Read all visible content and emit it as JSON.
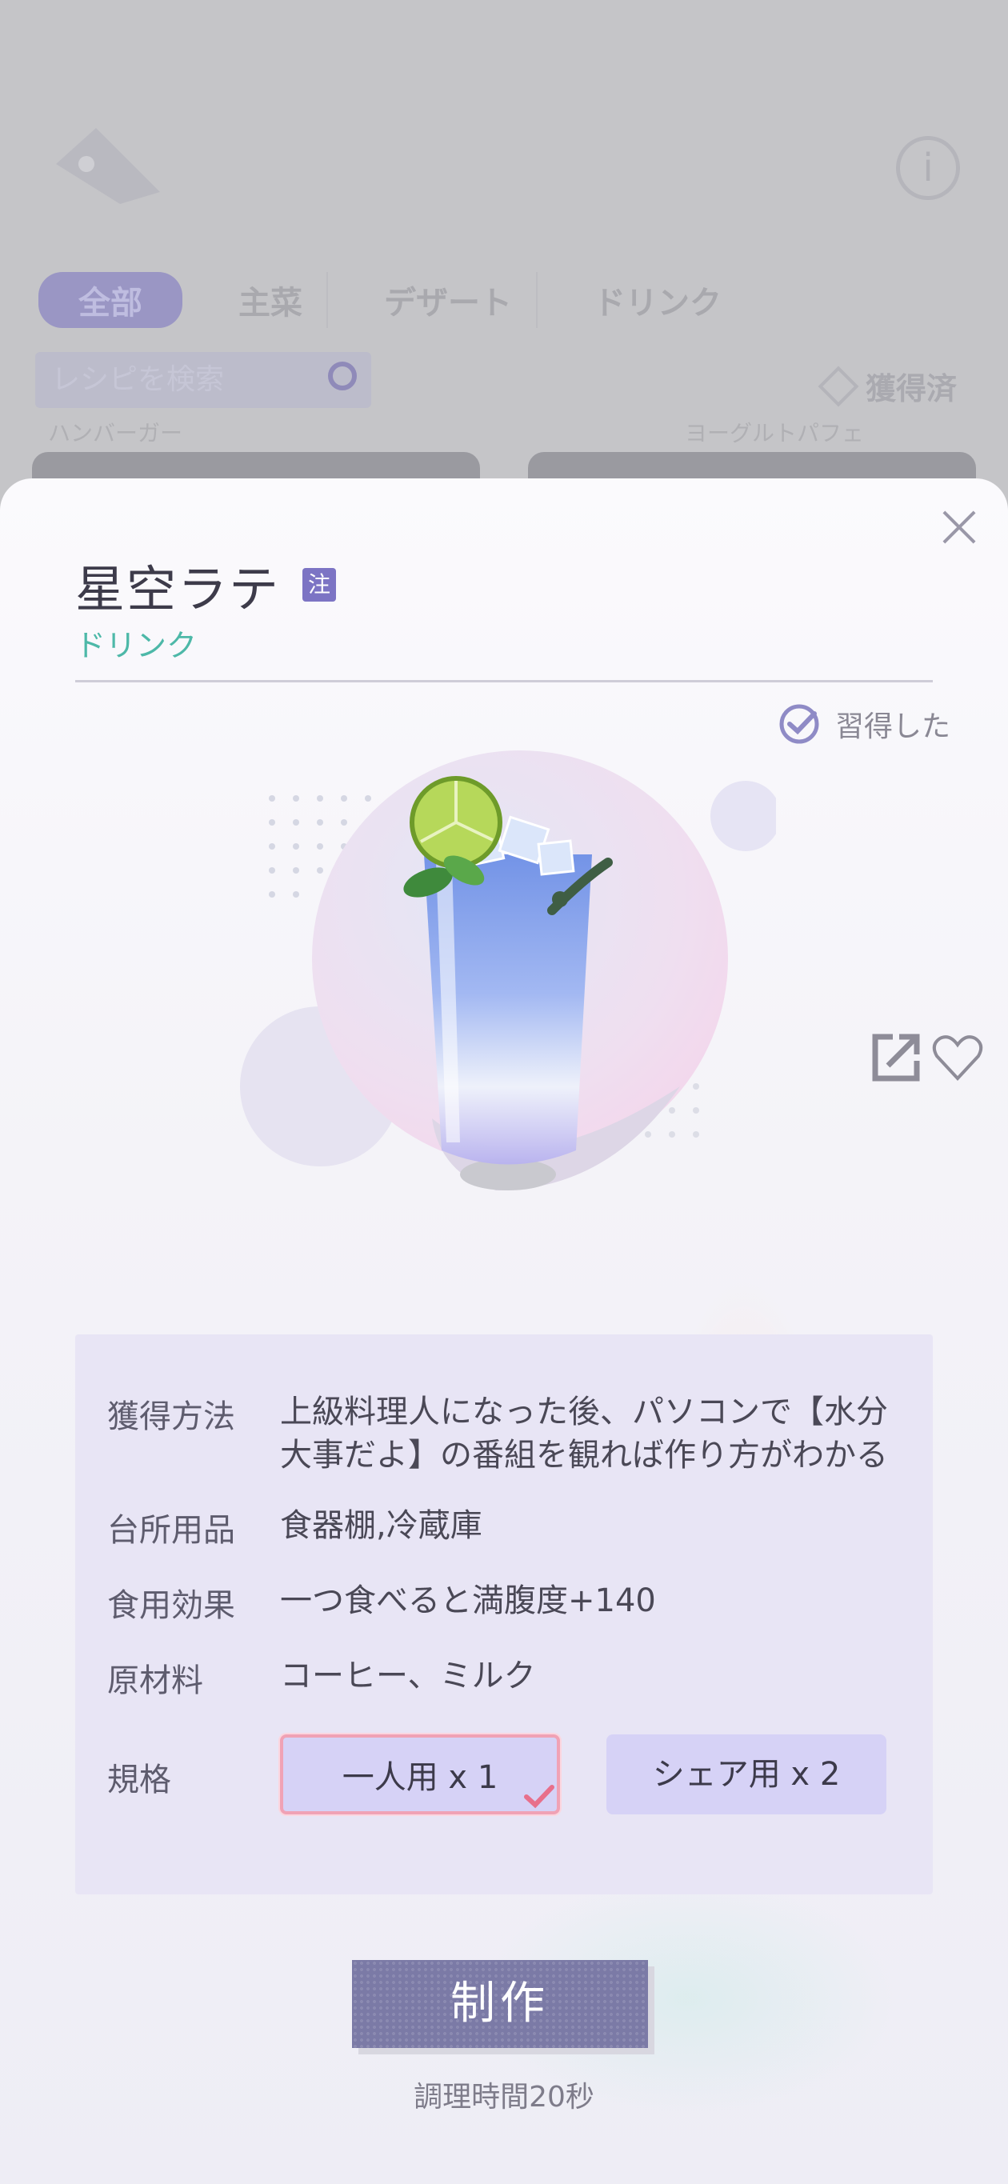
{
  "background": {
    "tabs": [
      "全部",
      "主菜",
      "デザート",
      "ドリンク"
    ],
    "search_placeholder": "レシピを検索",
    "filter_label": "獲得済",
    "list_labels": [
      "ハンバーガー",
      "ヨーグルトパフェ"
    ]
  },
  "dish": {
    "title": "星空ラテ",
    "note_badge": "注",
    "category": "ドリンク",
    "learned_label": "習得した"
  },
  "info": {
    "acquire_label": "獲得方法",
    "acquire_value": "上級料理人になった後、パソコンで【水分大事だよ】の番組を観れば作り方がわかる",
    "kitchen_label": "台所用品",
    "kitchen_value": "食器棚,冷蔵庫",
    "effect_label": "食用効果",
    "effect_value": "一つ食べると満腹度+140",
    "ingredients_label": "原材料",
    "ingredients_value": "コーヒー、ミルク",
    "spec_label": "規格",
    "specs": [
      "一人用 x 1",
      "シェア用 x 2"
    ],
    "selected_spec": "一人用 x 1"
  },
  "actions": {
    "make_label": "制作",
    "cook_time": "調理時間20秒"
  },
  "colors": {
    "accent": "#7c74c4",
    "category": "#4db8a8",
    "panel": "#e8e5f5",
    "spec_button": "#d6d2f6",
    "make_button": "#7b7aa6"
  }
}
